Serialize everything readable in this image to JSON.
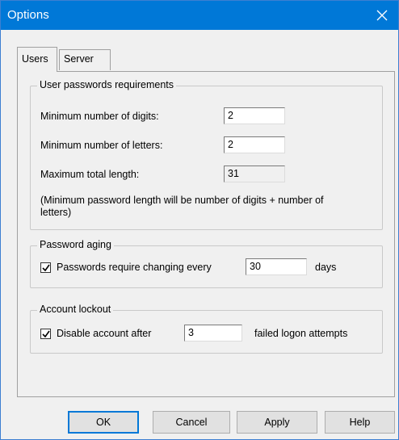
{
  "window": {
    "title": "Options"
  },
  "tabs": [
    {
      "label": "Users",
      "active": true
    },
    {
      "label": "Server",
      "active": false
    }
  ],
  "passwords": {
    "group_title": "User passwords requirements",
    "min_digits_label": "Minimum number of digits:",
    "min_digits_value": "2",
    "min_letters_label": "Minimum number of letters:",
    "min_letters_value": "2",
    "max_length_label": "Maximum total length:",
    "max_length_value": "31",
    "note": "(Minimum password length will be number of digits + number of letters)"
  },
  "aging": {
    "group_title": "Password aging",
    "checkbox_label": "Passwords require changing every",
    "checked": true,
    "days_value": "30",
    "days_unit": "days"
  },
  "lockout": {
    "group_title": "Account lockout",
    "checkbox_label": "Disable account after",
    "checked": true,
    "attempts_value": "3",
    "attempts_suffix": "failed logon attempts"
  },
  "buttons": {
    "ok": "OK",
    "cancel": "Cancel",
    "apply": "Apply",
    "help": "Help"
  },
  "colors": {
    "titlebar": "#0078d7",
    "dialog_bg": "#f0f0f0",
    "default_button_border": "#0078d7"
  },
  "icons": {
    "close": "close-icon",
    "check": "checkmark-icon"
  }
}
